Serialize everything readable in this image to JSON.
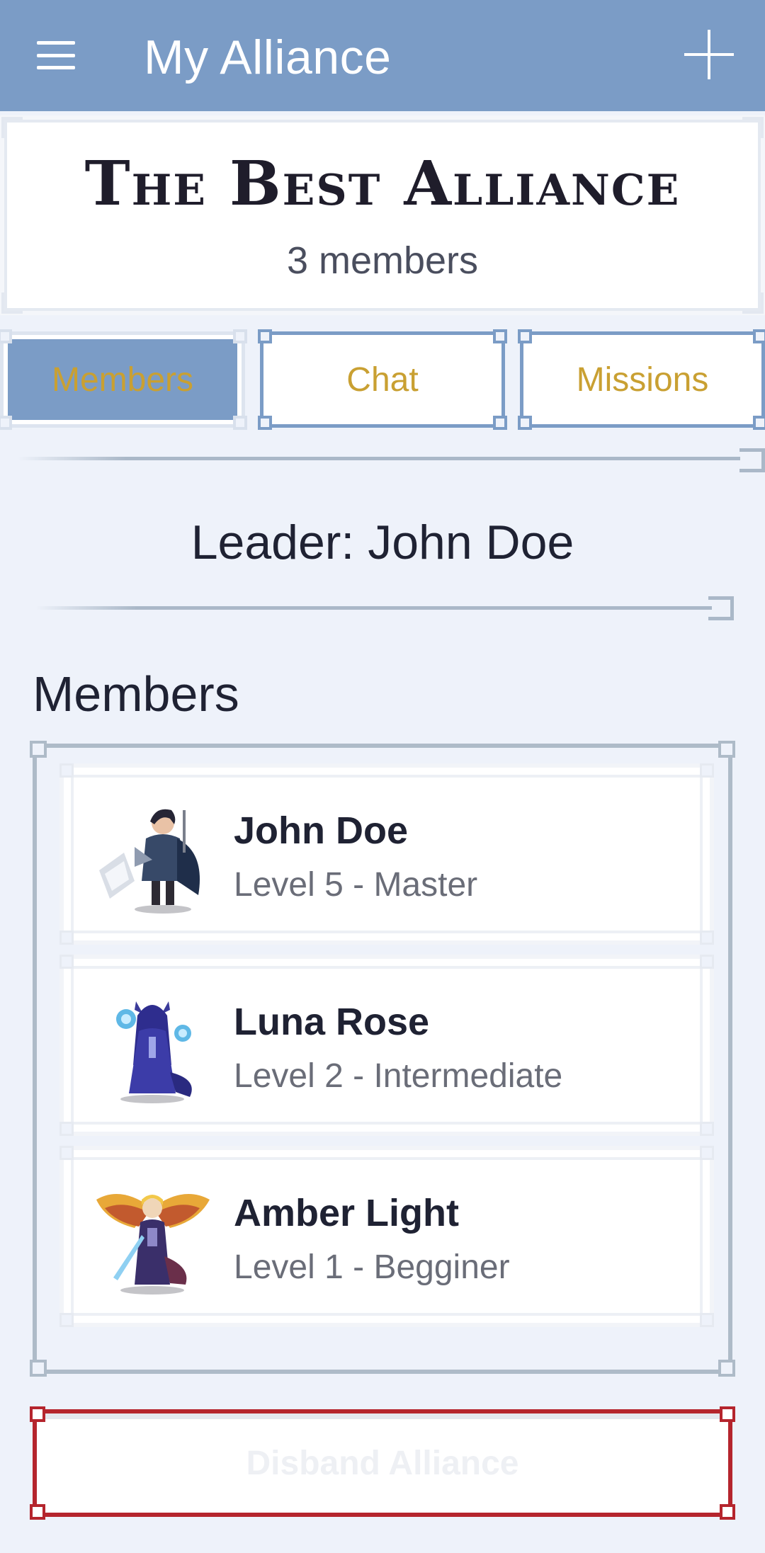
{
  "appbar": {
    "title": "My Alliance",
    "menu_icon": "hamburger-menu-icon",
    "add_icon": "plus-icon",
    "background": "#7b9cc6"
  },
  "alliance": {
    "name": "The Best Alliance",
    "member_count_label": "3 members"
  },
  "tabs": [
    {
      "label": "Members",
      "active": true
    },
    {
      "label": "Chat",
      "active": false
    },
    {
      "label": "Missions",
      "active": false
    }
  ],
  "leader": {
    "label": "Leader: John Doe"
  },
  "members_section": {
    "title": "Members",
    "items": [
      {
        "name": "John Doe",
        "level": "Level 5 - Master",
        "avatar": "knight-avatar-icon"
      },
      {
        "name": "Luna Rose",
        "level": "Level 2 - Intermediate",
        "avatar": "sorceress-avatar-icon"
      },
      {
        "name": "Amber Light",
        "level": "Level 1 - Begginer",
        "avatar": "winged-warrior-avatar-icon"
      }
    ]
  },
  "actions": {
    "disband_label": "Disband Alliance"
  },
  "colors": {
    "accent": "#7b9cc6",
    "tab_text": "#c9a032",
    "danger": "#b5252d",
    "background": "#eef2fa"
  }
}
